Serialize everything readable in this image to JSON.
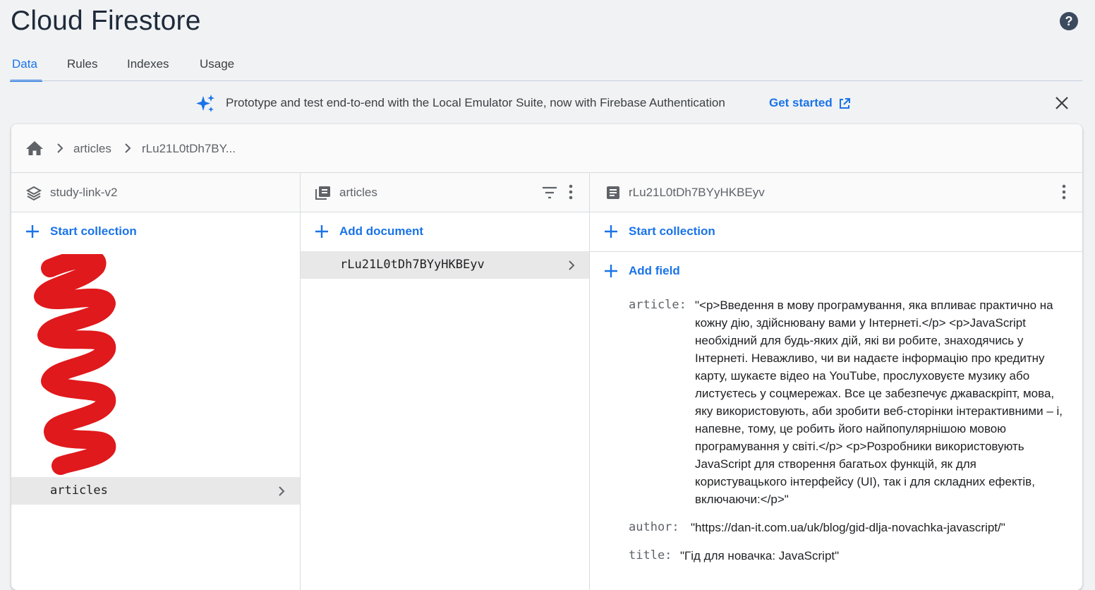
{
  "app": {
    "title": "Cloud Firestore"
  },
  "tabs": [
    {
      "label": "Data",
      "active": true
    },
    {
      "label": "Rules",
      "active": false
    },
    {
      "label": "Indexes",
      "active": false
    },
    {
      "label": "Usage",
      "active": false
    }
  ],
  "banner": {
    "message": "Prototype and test end-to-end with the Local Emulator Suite, now with Firebase Authentication",
    "cta": "Get started"
  },
  "breadcrumb": {
    "items": [
      "articles",
      "rLu21L0tDh7BY..."
    ]
  },
  "columns": {
    "root": {
      "title": "study-link-v2",
      "action": "Start collection",
      "selected_item": "articles"
    },
    "collection": {
      "title": "articles",
      "action": "Add document",
      "selected_item": "rLu21L0tDh7BYyHKBEyv"
    },
    "document": {
      "title": "rLu21L0tDh7BYyHKBEyv",
      "action": "Start collection",
      "add_field": "Add field",
      "fields": [
        {
          "key": "article:",
          "value": "\"<p>Введення в мову програмування, яка впливає практично на кожну дію, здійснювану вами у Інтернеті.</p> <p>JavaScript необхідний для будь-яких дій, які ви робите, знаходячись у Інтернеті. Неважливо, чи ви надаєте інформацію про кредитну карту, шукаєте відео на YouTube, прослуховуєте музику або листуєтесь у соцмережах. Все це забезпечує джаваскріпт, мова, яку використовують, аби зробити веб-сторінки інтерактивними – і, напевне, тому, це робить його найпопулярнішою мовою програмування у світі.</p> <p>Розробники використовують JavaScript для створення багатьох функцій, як для користувацького інтерфейсу (UI), так і для складних ефектів, включаючи:</p>\""
        },
        {
          "key": "author:",
          "value": "\"https://dan-it.com.ua/uk/blog/gid-dlja-novachka-javascript/\""
        },
        {
          "key": "title:",
          "value": "\"Гід для новачка: JavaScript\""
        }
      ]
    }
  },
  "colors": {
    "accent": "#1a73e8",
    "redaction": "#e0191c"
  }
}
